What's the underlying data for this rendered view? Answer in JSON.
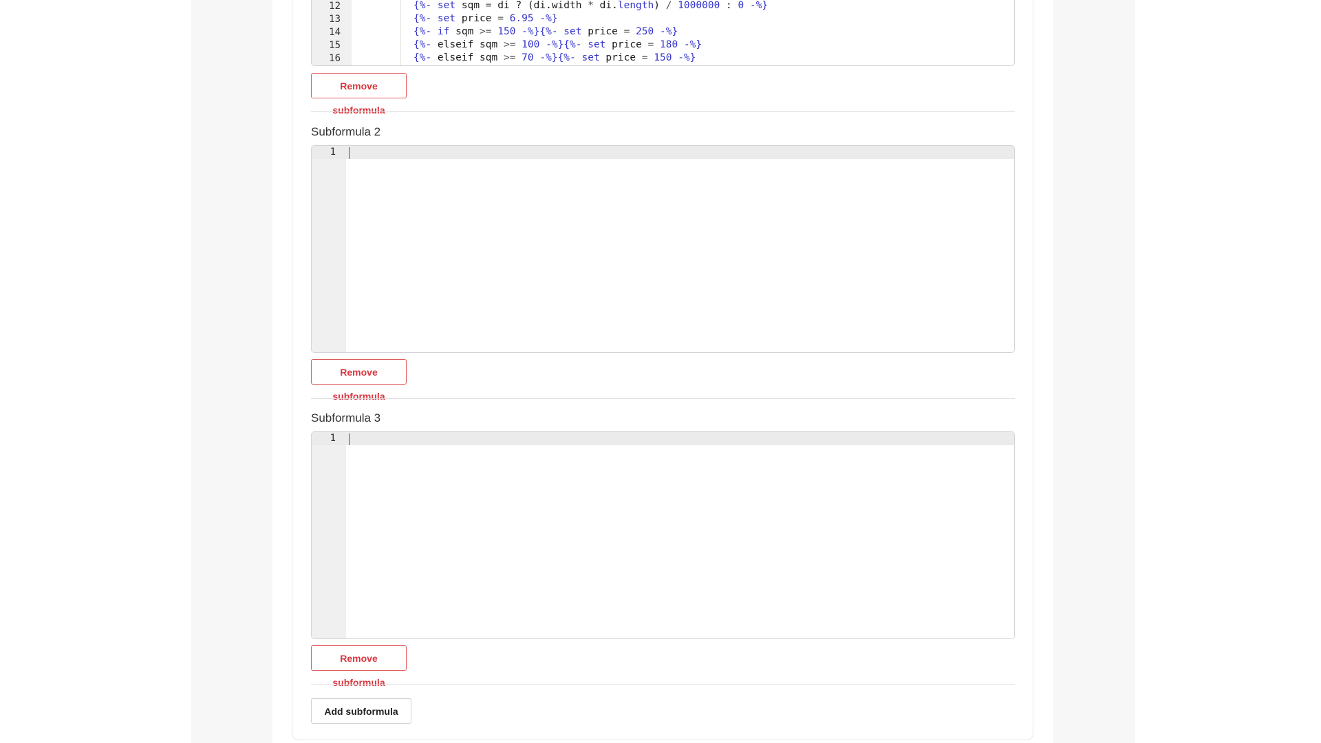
{
  "editor1": {
    "line_numbers": [
      "12",
      "13",
      "14",
      "15",
      "16"
    ],
    "lines": [
      [
        {
          "t": "{%- ",
          "c": "d"
        },
        {
          "t": "set",
          "c": "k"
        },
        {
          "t": " sqm ",
          "c": ""
        },
        {
          "t": "=",
          "c": "p"
        },
        {
          "t": " di ",
          "c": ""
        },
        {
          "t": "?",
          "c": ""
        },
        {
          "t": " (di.width ",
          "c": ""
        },
        {
          "t": "*",
          "c": "p"
        },
        {
          "t": " di.",
          "c": ""
        },
        {
          "t": "length",
          "c": "k"
        },
        {
          "t": ") ",
          "c": ""
        },
        {
          "t": "/",
          "c": "p"
        },
        {
          "t": " ",
          "c": ""
        },
        {
          "t": "1000000",
          "c": "n"
        },
        {
          "t": " : ",
          "c": ""
        },
        {
          "t": "0",
          "c": "n"
        },
        {
          "t": " -%}",
          "c": "d"
        }
      ],
      [
        {
          "t": "{%- ",
          "c": "d"
        },
        {
          "t": "set",
          "c": "k"
        },
        {
          "t": " price ",
          "c": ""
        },
        {
          "t": "=",
          "c": "p"
        },
        {
          "t": " ",
          "c": ""
        },
        {
          "t": "6.95",
          "c": "n"
        },
        {
          "t": " -%}",
          "c": "d"
        }
      ],
      [
        {
          "t": "{%- ",
          "c": "d"
        },
        {
          "t": "if",
          "c": "k"
        },
        {
          "t": " sqm ",
          "c": ""
        },
        {
          "t": ">=",
          "c": "p"
        },
        {
          "t": " ",
          "c": ""
        },
        {
          "t": "150",
          "c": "n"
        },
        {
          "t": " -%}",
          "c": "d"
        },
        {
          "t": "{%- ",
          "c": "d"
        },
        {
          "t": "set",
          "c": "k"
        },
        {
          "t": " price ",
          "c": ""
        },
        {
          "t": "=",
          "c": "p"
        },
        {
          "t": " ",
          "c": ""
        },
        {
          "t": "250",
          "c": "n"
        },
        {
          "t": " -%}",
          "c": "d"
        }
      ],
      [
        {
          "t": "{%- ",
          "c": "d"
        },
        {
          "t": "elseif",
          "c": ""
        },
        {
          "t": " sqm ",
          "c": ""
        },
        {
          "t": ">=",
          "c": "p"
        },
        {
          "t": " ",
          "c": ""
        },
        {
          "t": "100",
          "c": "n"
        },
        {
          "t": " -%}",
          "c": "d"
        },
        {
          "t": "{%- ",
          "c": "d"
        },
        {
          "t": "set",
          "c": "k"
        },
        {
          "t": " price ",
          "c": ""
        },
        {
          "t": "=",
          "c": "p"
        },
        {
          "t": " ",
          "c": ""
        },
        {
          "t": "180",
          "c": "n"
        },
        {
          "t": " -%}",
          "c": "d"
        }
      ],
      [
        {
          "t": "{%- ",
          "c": "d"
        },
        {
          "t": "elseif",
          "c": ""
        },
        {
          "t": " sqm ",
          "c": ""
        },
        {
          "t": ">=",
          "c": "p"
        },
        {
          "t": " ",
          "c": ""
        },
        {
          "t": "70",
          "c": "n"
        },
        {
          "t": " -%}",
          "c": "d"
        },
        {
          "t": "{%- ",
          "c": "d"
        },
        {
          "t": "set",
          "c": "k"
        },
        {
          "t": " price ",
          "c": ""
        },
        {
          "t": "=",
          "c": "p"
        },
        {
          "t": " ",
          "c": ""
        },
        {
          "t": "150",
          "c": "n"
        },
        {
          "t": " -%}",
          "c": "d"
        }
      ]
    ],
    "remove_label": "Remove subformula"
  },
  "subformula2": {
    "title": "Subformula 2",
    "line_number": "1",
    "remove_label": "Remove subformula"
  },
  "subformula3": {
    "title": "Subformula 3",
    "line_number": "1",
    "remove_label": "Remove subformula"
  },
  "add_label": "Add subformula"
}
